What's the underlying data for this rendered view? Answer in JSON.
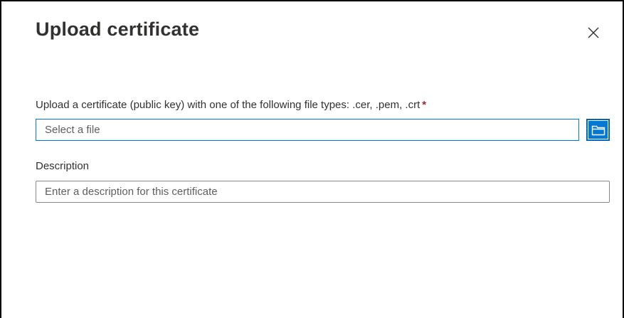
{
  "dialog": {
    "title": "Upload certificate",
    "close_icon": "close-icon"
  },
  "file_field": {
    "label": "Upload a certificate (public key) with one of the following file types: .cer, .pem, .crt",
    "required_marker": "*",
    "placeholder": "Select a file",
    "value": "",
    "browse_icon": "folder-icon"
  },
  "description_field": {
    "label": "Description",
    "placeholder": "Enter a description for this certificate",
    "value": ""
  },
  "colors": {
    "accent": "#0078d4",
    "required": "#a4262c",
    "text": "#323130",
    "placeholder": "#605e5c"
  }
}
